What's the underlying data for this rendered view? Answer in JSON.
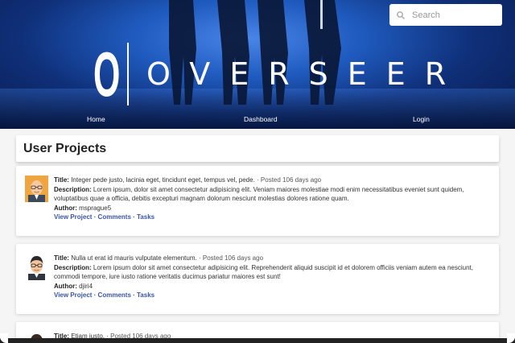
{
  "header": {
    "logo_letter": "O",
    "logo_text": "OVERSEER",
    "search_placeholder": "Search"
  },
  "nav": {
    "items": [
      "Home",
      "Dashboard",
      "Login"
    ]
  },
  "page": {
    "title": "User Projects"
  },
  "labels": {
    "title": "Title:",
    "description": "Description:",
    "author": "Author:",
    "view_project": "View Project",
    "comments": "Comments",
    "tasks": "Tasks",
    "separator": " · "
  },
  "projects": [
    {
      "title": "Integer pede justo, lacinia eget, tincidunt eget, tempus vel, pede.",
      "posted": "· Posted 106 days ago",
      "description": "Lorem ipsum, dolor sit amet consectetur adipisicing elit. Veniam maiores molestiae modi enim necessitatibus eveniet sunt quidem, voluptatibus quae a officia, debitis excepturi magnam dolorum nesciunt molestias dolores ratione quam.",
      "author": "msprague5",
      "avatar_icon": "man-blonde-glasses-avatar-icon"
    },
    {
      "title": "Nulla ut erat id mauris vulputate elementum.",
      "posted": "· Posted 106 days ago",
      "description": "Lorem ipsum dolor sit amet consectetur adipisicing elit. Reprehenderit aliquid suscipit id et dolorem officiis veniam autem ea nesciunt, commodi tempore, iure iusto ratione veritatis ducimus pariatur maiores est sunt!",
      "author": "djiri4",
      "avatar_icon": "man-dark-hair-glasses-avatar-icon"
    },
    {
      "title": "Etiam justo.",
      "posted": "· Posted 106 days ago",
      "avatar_icon": "man-dark-hair-avatar-icon"
    }
  ],
  "colors": {
    "banner_blue": "#1f5bbf",
    "link_blue": "#3a56a8"
  }
}
